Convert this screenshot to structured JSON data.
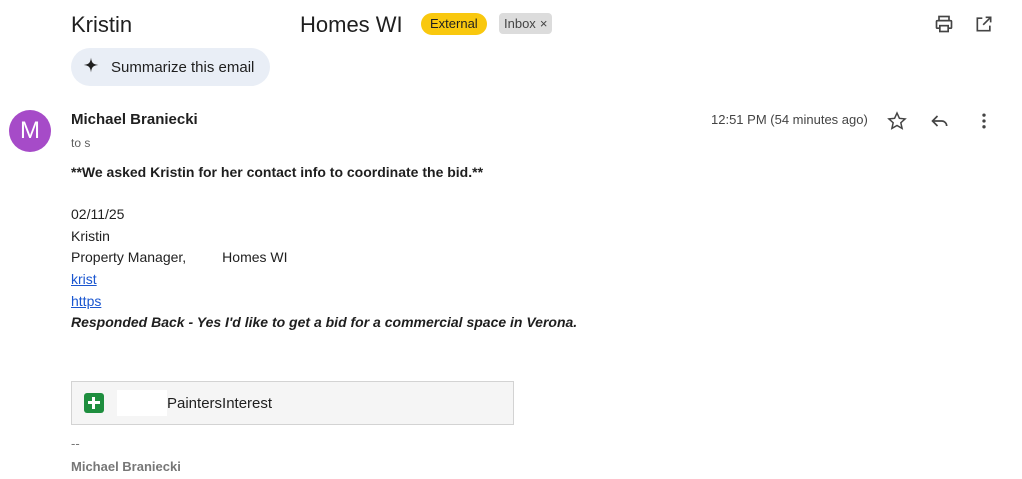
{
  "header": {
    "subject_part1": "Kristin",
    "subject_part2": "Homes WI",
    "label_external": "External",
    "label_inbox": "Inbox",
    "label_inbox_remove": "×",
    "print_icon": "print-icon",
    "open_new_window_icon": "open-in-new-icon"
  },
  "summarize": {
    "icon": "sparkle-icon",
    "label": "Summarize this email"
  },
  "message": {
    "avatar_letter": "M",
    "avatar_color": "#a64bc8",
    "sender": "Michael Braniecki",
    "to": "to s",
    "time": "12:51 PM (54 minutes ago)",
    "actions": [
      "star-icon",
      "reply-icon",
      "more-vert-icon"
    ]
  },
  "body": {
    "line1": "**We asked Kristin for her contact info to coordinate the bid.**",
    "date": "02/11/25",
    "name": "Kristin",
    "title_prefix": "Property Manager,",
    "title_suffix": "Homes WI",
    "link1": "krist",
    "link2": "https",
    "response": "Responded Back - Yes I'd like to get a bid for a commercial space in Verona."
  },
  "attachment": {
    "icon": "google-sheets-icon",
    "name": "PaintersInterest"
  },
  "signature": {
    "dash": "--",
    "name": "Michael Braniecki"
  }
}
